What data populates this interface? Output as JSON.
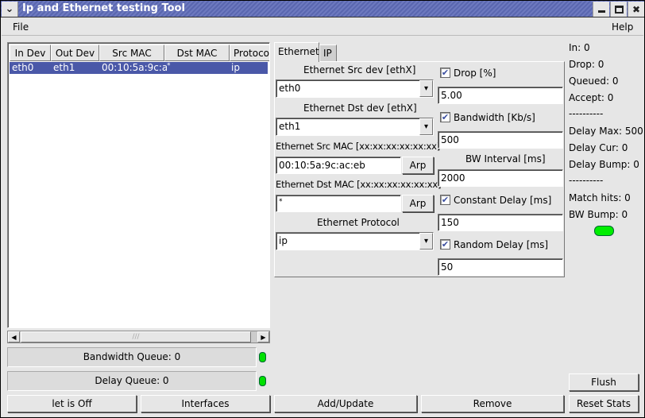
{
  "window": {
    "title": "Ip and Ethernet testing Tool",
    "controls": [
      "menu-icon",
      "minimize-icon",
      "maximize-icon",
      "close-icon"
    ]
  },
  "menubar": {
    "file": "File",
    "help": "Help"
  },
  "rules_table": {
    "columns": [
      "In Dev",
      "Out Dev",
      "Src MAC",
      "Dst MAC",
      "Protocol"
    ],
    "rows": [
      {
        "in_dev": "eth0",
        "out_dev": "eth1",
        "src_mac": "00:10:5a:9c:a",
        "dst_mac": "*",
        "protocol": "ip",
        "selected": true
      }
    ]
  },
  "queues": {
    "bandwidth": "Bandwidth Queue: 0",
    "delay": "Delay Queue: 0",
    "led_color": "#00e000"
  },
  "tabs": [
    {
      "label": "Ethernet",
      "active": true
    },
    {
      "label": "IP",
      "active": false
    }
  ],
  "ethernet": {
    "src_dev_label": "Ethernet Src dev [ethX]",
    "src_dev_value": "eth0",
    "dst_dev_label": "Ethernet Dst dev [ethX]",
    "dst_dev_value": "eth1",
    "src_mac_label": "Ethernet Src MAC [xx:xx:xx:xx:xx:xx]",
    "src_mac_value": "00:10:5a:9c:ac:eb",
    "dst_mac_label": "Ethernet Dst MAC [xx:xx:xx:xx:xx:xx]",
    "dst_mac_value": "*",
    "arp_label": "Arp",
    "protocol_label": "Ethernet Protocol",
    "protocol_value": "ip"
  },
  "params": {
    "drop": {
      "label": "Drop [%]",
      "checked": true,
      "value": "5.00"
    },
    "bandwidth": {
      "label": "Bandwidth [Kb/s]",
      "checked": true,
      "value": "500"
    },
    "bw_interval": {
      "label": "BW Interval [ms]",
      "value": "2000"
    },
    "constant_delay": {
      "label": "Constant Delay [ms]",
      "checked": true,
      "value": "150"
    },
    "random_delay": {
      "label": "Random Delay [ms]",
      "checked": true,
      "value": "50"
    }
  },
  "stats": {
    "in": "In: 0",
    "drop": "Drop: 0",
    "queued": "Queued: 0",
    "accept": "Accept: 0",
    "sep1": "----------",
    "delay_max": "Delay Max: 500",
    "delay_cur": "Delay Cur: 0",
    "delay_bump": "Delay Bump: 0",
    "sep2": "----------",
    "match_hits": "Match hits: 0",
    "bw_bump": "BW Bump: 0",
    "led_color": "#00ee00"
  },
  "buttons": {
    "net_toggle": "let is Off",
    "interfaces": "Interfaces",
    "add_update": "Add/Update",
    "remove": "Remove",
    "flush": "Flush",
    "reset_stats": "Reset Stats"
  },
  "checkmark": "✔"
}
